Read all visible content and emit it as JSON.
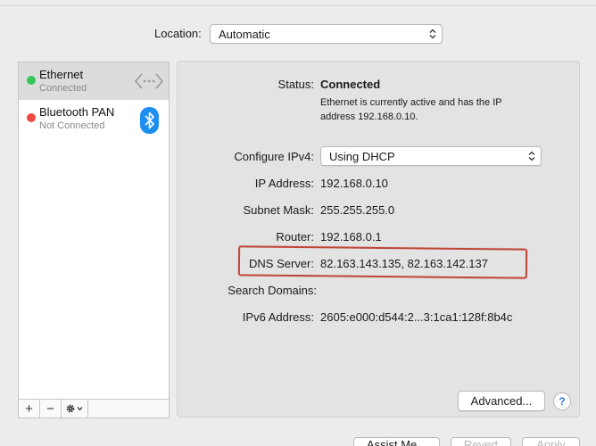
{
  "location": {
    "label": "Location:",
    "value": "Automatic"
  },
  "services": [
    {
      "name": "Ethernet",
      "status": "Connected",
      "status_color": "#34c759",
      "icon": "ethernet-icon",
      "selected": true
    },
    {
      "name": "Bluetooth PAN",
      "status": "Not Connected",
      "status_color": "#ee4a44",
      "icon": "bluetooth-icon",
      "selected": false
    }
  ],
  "toolbar": {
    "add": "+",
    "remove": "−",
    "gear": "gear-icon"
  },
  "details": {
    "status_label": "Status:",
    "status_value": "Connected",
    "status_description": "Ethernet is currently active and has the IP address 192.168.0.10.",
    "configure_label": "Configure IPv4:",
    "configure_value": "Using DHCP",
    "ip_label": "IP Address:",
    "ip_value": "192.168.0.10",
    "subnet_label": "Subnet Mask:",
    "subnet_value": "255.255.255.0",
    "router_label": "Router:",
    "router_value": "192.168.0.1",
    "dns_label": "DNS Server:",
    "dns_value": "82.163.143.135, 82.163.142.137",
    "search_label": "Search Domains:",
    "search_value": "",
    "ipv6_label": "IPv6 Address:",
    "ipv6_value": "2605:e000:d544:2...3:1ca1:128f:8b4c",
    "advanced_button": "Advanced...",
    "help_button": "?"
  },
  "buttons": {
    "assist": "Assist Me...",
    "revert": "Revert",
    "apply": "Apply"
  },
  "colors": {
    "highlight": "#c0463a",
    "bluetooth": "#1f8ef1"
  }
}
